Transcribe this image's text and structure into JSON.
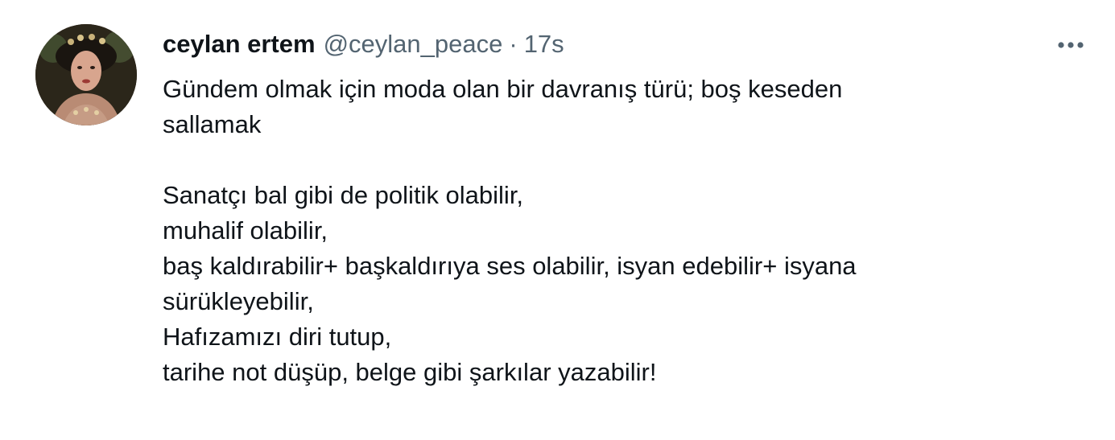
{
  "tweet": {
    "author": {
      "display_name": "ceylan ertem",
      "handle": "@ceylan_peace"
    },
    "separator": "·",
    "time": "17s",
    "more_icon": "more-dots-icon",
    "text_lines": [
      "Gündem olmak için moda olan bir davranış türü; boş keseden",
      "sallamak",
      "",
      "Sanatçı bal gibi de politik olabilir,",
      "muhalif olabilir,",
      "baş kaldırabilir+ başkaldırıya ses olabilir, isyan edebilir+ isyana",
      "sürükleyebilir,",
      "Hafızamızı diri tutup,",
      "tarihe not düşüp, belge gibi şarkılar yazabilir!"
    ]
  },
  "colors": {
    "primary_text": "#0f1419",
    "secondary_text": "#536471",
    "background": "#ffffff"
  }
}
